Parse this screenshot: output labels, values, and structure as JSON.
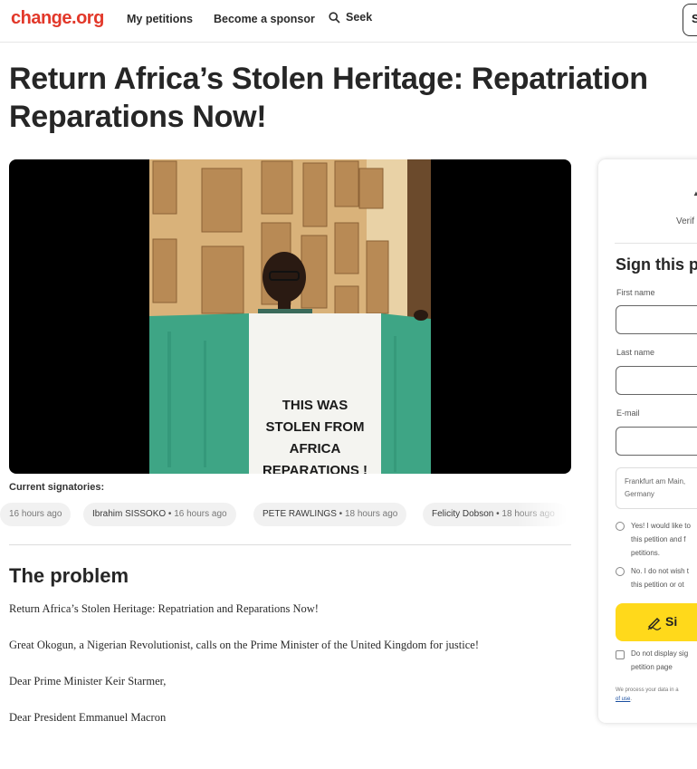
{
  "header": {
    "logo": "change.org",
    "nav": [
      "My petitions",
      "Become a sponsor"
    ],
    "search_label": "Seek",
    "right_button_label": "S"
  },
  "petition": {
    "title": "Return Africa’s Stolen Heritage: Repatriation Reparations Now!",
    "image_sign_text": [
      "THIS WAS",
      "STOLEN FROM",
      "AFRICA",
      "REPARATIONS !"
    ]
  },
  "signatories": {
    "label": "Current signatories:",
    "items": [
      {
        "name": "",
        "ago": "16 hours ago"
      },
      {
        "name": "Ibrahim SISSOKO",
        "ago": "16 hours ago"
      },
      {
        "name": "PETE RAWLINGS",
        "ago": "18 hours ago"
      },
      {
        "name": "Felicity Dobson",
        "ago": "18 hours ago"
      }
    ]
  },
  "problem": {
    "heading": "The problem",
    "paragraphs": [
      "Return Africa’s Stolen Heritage: Repatriation and Reparations Now!",
      "Great Okogun, a Nigerian Revolutionist, calls on the Prime Minister of the United Kingdom for justice!",
      "Dear Prime Minister Keir Starmer,",
      "Dear President Emmanuel Macron"
    ]
  },
  "sign_card": {
    "verified_text": "Verif",
    "title": "Sign this pe",
    "first_name_label": "First name",
    "last_name_label": "Last name",
    "email_label": "E-mail",
    "location_line1": "Frankfurt am Main,",
    "location_line2": "Germany",
    "option_yes": [
      "Yes! I would like to",
      "this petition and f",
      "petitions."
    ],
    "option_no": [
      "No. I do not wish t",
      "this petition or ot"
    ],
    "sign_button": "Si",
    "hide_signature": [
      "Do not display sig",
      "petition page"
    ],
    "privacy_line1": "We process your data in a",
    "privacy_link": "of use"
  },
  "colors": {
    "brand_red": "#e2382a",
    "sign_button_yellow": "#ffd91b",
    "flag_green": "#3ea585",
    "flag_white": "#f4f4f0"
  }
}
